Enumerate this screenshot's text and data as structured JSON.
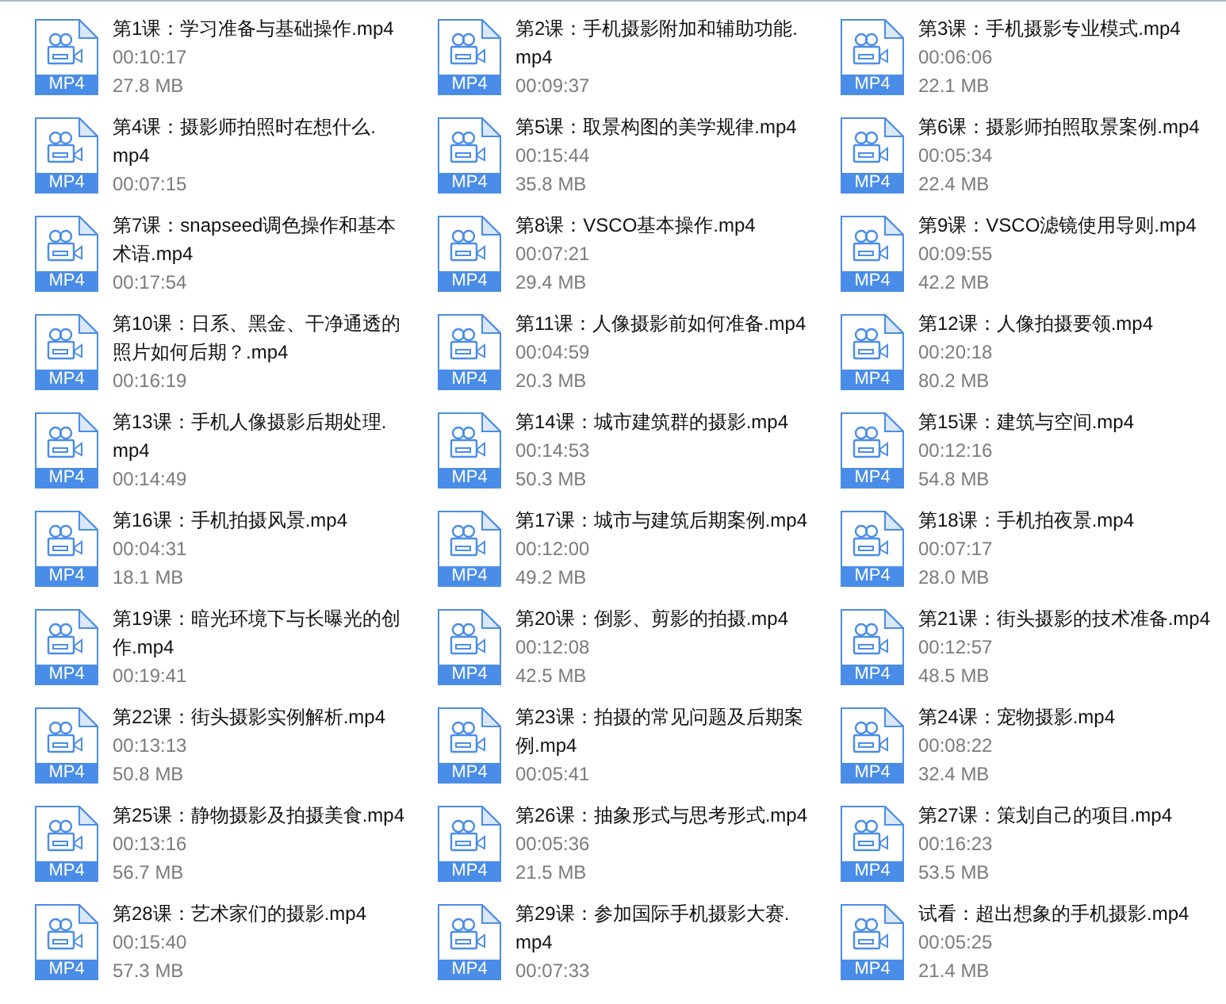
{
  "files": [
    {
      "name_lines": [
        "第1课：学习准备与基础操作.mp4"
      ],
      "duration": "00:10:17",
      "size": "27.8 MB",
      "badge": "MP4"
    },
    {
      "name_lines": [
        "第2课：手机摄影附加和辅助功能.",
        "mp4"
      ],
      "duration": "00:09:37",
      "badge": "MP4"
    },
    {
      "name_lines": [
        "第3课：手机摄影专业模式.mp4"
      ],
      "duration": "00:06:06",
      "size": "22.1 MB",
      "badge": "MP4"
    },
    {
      "name_lines": [
        "第4课：摄影师拍照时在想什么.",
        "mp4"
      ],
      "duration": "00:07:15",
      "badge": "MP4"
    },
    {
      "name_lines": [
        "第5课：取景构图的美学规律.mp4"
      ],
      "duration": "00:15:44",
      "size": "35.8 MB",
      "badge": "MP4"
    },
    {
      "name_lines": [
        "第6课：摄影师拍照取景案例.mp4"
      ],
      "duration": "00:05:34",
      "size": "22.4 MB",
      "badge": "MP4"
    },
    {
      "name_lines": [
        "第7课：snapseed调色操作和基本",
        "术语.mp4"
      ],
      "duration": "00:17:54",
      "badge": "MP4"
    },
    {
      "name_lines": [
        "第8课：VSCO基本操作.mp4"
      ],
      "duration": "00:07:21",
      "size": "29.4 MB",
      "badge": "MP4"
    },
    {
      "name_lines": [
        "第9课：VSCO滤镜使用导则.mp4"
      ],
      "duration": "00:09:55",
      "size": "42.2 MB",
      "badge": "MP4"
    },
    {
      "name_lines": [
        "第10课：日系、黑金、干净通透的",
        "照片如何后期？.mp4"
      ],
      "duration": "00:16:19",
      "badge": "MP4"
    },
    {
      "name_lines": [
        "第11课：人像摄影前如何准备.mp4"
      ],
      "duration": "00:04:59",
      "size": "20.3 MB",
      "badge": "MP4"
    },
    {
      "name_lines": [
        "第12课：人像拍摄要领.mp4"
      ],
      "duration": "00:20:18",
      "size": "80.2 MB",
      "badge": "MP4"
    },
    {
      "name_lines": [
        "第13课：手机人像摄影后期处理.",
        "mp4"
      ],
      "duration": "00:14:49",
      "badge": "MP4"
    },
    {
      "name_lines": [
        "第14课：城市建筑群的摄影.mp4"
      ],
      "duration": "00:14:53",
      "size": "50.3 MB",
      "badge": "MP4"
    },
    {
      "name_lines": [
        "第15课：建筑与空间.mp4"
      ],
      "duration": "00:12:16",
      "size": "54.8 MB",
      "badge": "MP4"
    },
    {
      "name_lines": [
        "第16课：手机拍摄风景.mp4"
      ],
      "duration": "00:04:31",
      "size": "18.1 MB",
      "badge": "MP4"
    },
    {
      "name_lines": [
        "第17课：城市与建筑后期案例.mp4"
      ],
      "duration": "00:12:00",
      "size": "49.2 MB",
      "badge": "MP4"
    },
    {
      "name_lines": [
        "第18课：手机拍夜景.mp4"
      ],
      "duration": "00:07:17",
      "size": "28.0 MB",
      "badge": "MP4"
    },
    {
      "name_lines": [
        "第19课：暗光环境下与长曝光的创",
        "作.mp4"
      ],
      "duration": "00:19:41",
      "badge": "MP4"
    },
    {
      "name_lines": [
        "第20课：倒影、剪影的拍摄.mp4"
      ],
      "duration": "00:12:08",
      "size": "42.5 MB",
      "badge": "MP4"
    },
    {
      "name_lines": [
        "第21课：街头摄影的技术准备.mp4"
      ],
      "duration": "00:12:57",
      "size": "48.5 MB",
      "badge": "MP4"
    },
    {
      "name_lines": [
        "第22课：街头摄影实例解析.mp4"
      ],
      "duration": "00:13:13",
      "size": "50.8 MB",
      "badge": "MP4"
    },
    {
      "name_lines": [
        "第23课：拍摄的常见问题及后期案",
        "例.mp4"
      ],
      "duration": "00:05:41",
      "badge": "MP4"
    },
    {
      "name_lines": [
        "第24课：宠物摄影.mp4"
      ],
      "duration": "00:08:22",
      "size": "32.4 MB",
      "badge": "MP4"
    },
    {
      "name_lines": [
        "第25课：静物摄影及拍摄美食.mp4"
      ],
      "duration": "00:13:16",
      "size": "56.7 MB",
      "badge": "MP4"
    },
    {
      "name_lines": [
        "第26课：抽象形式与思考形式.mp4"
      ],
      "duration": "00:05:36",
      "size": "21.5 MB",
      "badge": "MP4"
    },
    {
      "name_lines": [
        "第27课：策划自己的项目.mp4"
      ],
      "duration": "00:16:23",
      "size": "53.5 MB",
      "badge": "MP4"
    },
    {
      "name_lines": [
        "第28课：艺术家们的摄影.mp4"
      ],
      "duration": "00:15:40",
      "size": "57.3 MB",
      "badge": "MP4"
    },
    {
      "name_lines": [
        "第29课：参加国际手机摄影大赛.",
        "mp4"
      ],
      "duration": "00:07:33",
      "badge": "MP4"
    },
    {
      "name_lines": [
        "试看：超出想象的手机摄影.mp4"
      ],
      "duration": "00:05:25",
      "size": "21.4 MB",
      "badge": "MP4"
    }
  ]
}
